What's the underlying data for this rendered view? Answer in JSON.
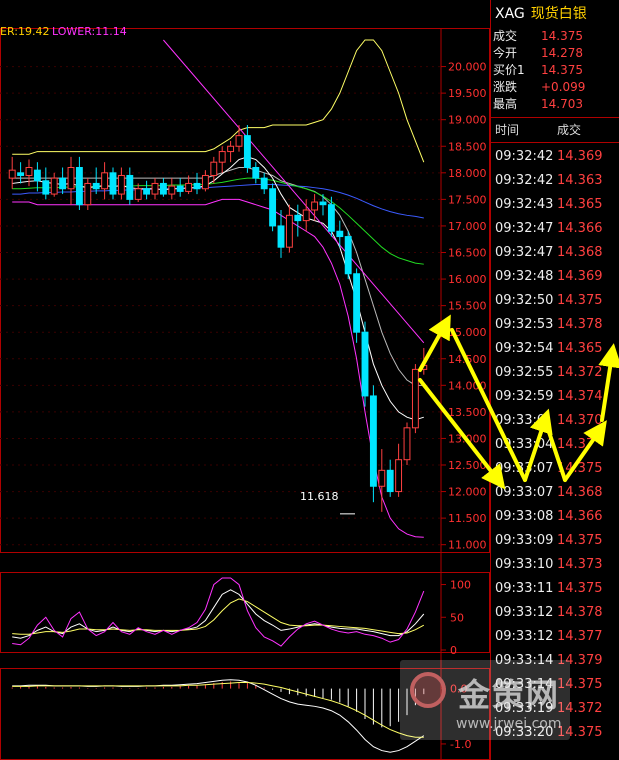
{
  "indicator_header": {
    "upper": "ER:19.42",
    "lower": "LOWER:11.14"
  },
  "low_label": "11.618",
  "price_axis": [
    "20.000",
    "19.500",
    "19.000",
    "18.500",
    "18.000",
    "17.500",
    "17.000",
    "16.500",
    "16.000",
    "15.500",
    "15.000",
    "14.500",
    "14.000",
    "13.500",
    "13.000",
    "12.500",
    "12.000",
    "11.500",
    "11.000"
  ],
  "kdj_axis": [
    "100",
    "50",
    "0"
  ],
  "macd_axis": [
    "0.0",
    "-1.0"
  ],
  "sidebar": {
    "code": "XAG",
    "name": "现货白银",
    "quote": [
      {
        "label": "成交",
        "value": "14.375"
      },
      {
        "label": "今开",
        "value": "14.278"
      },
      {
        "label": "买价1",
        "value": "14.375"
      },
      {
        "label": "涨跌",
        "value": "+0.099"
      },
      {
        "label": "最高",
        "value": "14.703"
      }
    ],
    "ticks_header": {
      "time": "时间",
      "price": "成交"
    },
    "ticks": [
      {
        "time": "09:32:42",
        "price": "14.369"
      },
      {
        "time": "09:32:42",
        "price": "14.363"
      },
      {
        "time": "09:32:43",
        "price": "14.365"
      },
      {
        "time": "09:32:47",
        "price": "14.366"
      },
      {
        "time": "09:32:47",
        "price": "14.368"
      },
      {
        "time": "09:32:48",
        "price": "14.369"
      },
      {
        "time": "09:32:50",
        "price": "14.375"
      },
      {
        "time": "09:32:53",
        "price": "14.378"
      },
      {
        "time": "09:32:54",
        "price": "14.365"
      },
      {
        "time": "09:32:55",
        "price": "14.372"
      },
      {
        "time": "09:32:59",
        "price": "14.374"
      },
      {
        "time": "09:33:0",
        "price": "14.370"
      },
      {
        "time": "09:33:04",
        "price": "14.37"
      },
      {
        "time": "09:33:07",
        "price": "14.375"
      },
      {
        "time": "09:33:07",
        "price": "14.368"
      },
      {
        "time": "09:33:08",
        "price": "14.366"
      },
      {
        "time": "09:33:09",
        "price": "14.375"
      },
      {
        "time": "09:33:10",
        "price": "14.373"
      },
      {
        "time": "09:33:11",
        "price": "14.375"
      },
      {
        "time": "09:33:12",
        "price": "14.378"
      },
      {
        "time": "09:33:12",
        "price": "14.377"
      },
      {
        "time": "09:33:14",
        "price": "14.379"
      },
      {
        "time": "09:33:14",
        "price": "14.375"
      },
      {
        "time": "09:33:19",
        "price": "14.372"
      },
      {
        "time": "09:33:20",
        "price": "14.375"
      }
    ]
  },
  "watermark": {
    "text": "金策网",
    "url": "www.jrwei.com"
  },
  "colors": {
    "up": "#ff4040",
    "down": "#00e5ff",
    "upper_band": "#ffff66",
    "lower_band": "#ff33ff",
    "arrow": "#ffff00"
  },
  "chart_data": {
    "type": "candlestick",
    "ylim": [
      10.9,
      20.5
    ],
    "candles": [
      {
        "o": 17.9,
        "h": 18.3,
        "l": 17.7,
        "c": 18.05
      },
      {
        "o": 18.0,
        "h": 18.2,
        "l": 17.8,
        "c": 17.95
      },
      {
        "o": 17.95,
        "h": 18.25,
        "l": 17.75,
        "c": 18.1
      },
      {
        "o": 18.05,
        "h": 18.2,
        "l": 17.65,
        "c": 17.85
      },
      {
        "o": 17.85,
        "h": 18.1,
        "l": 17.5,
        "c": 17.6
      },
      {
        "o": 17.6,
        "h": 18.0,
        "l": 17.55,
        "c": 17.9
      },
      {
        "o": 17.9,
        "h": 18.1,
        "l": 17.6,
        "c": 17.7
      },
      {
        "o": 17.7,
        "h": 18.3,
        "l": 17.4,
        "c": 18.1
      },
      {
        "o": 18.1,
        "h": 18.3,
        "l": 17.3,
        "c": 17.4
      },
      {
        "o": 17.4,
        "h": 17.9,
        "l": 17.3,
        "c": 17.8
      },
      {
        "o": 17.8,
        "h": 18.1,
        "l": 17.6,
        "c": 17.7
      },
      {
        "o": 17.7,
        "h": 18.2,
        "l": 17.5,
        "c": 18.0
      },
      {
        "o": 18.0,
        "h": 18.1,
        "l": 17.5,
        "c": 17.6
      },
      {
        "o": 17.6,
        "h": 18.1,
        "l": 17.5,
        "c": 17.95
      },
      {
        "o": 17.95,
        "h": 18.1,
        "l": 17.4,
        "c": 17.5
      },
      {
        "o": 17.5,
        "h": 17.8,
        "l": 17.45,
        "c": 17.7
      },
      {
        "o": 17.7,
        "h": 17.85,
        "l": 17.5,
        "c": 17.6
      },
      {
        "o": 17.6,
        "h": 17.9,
        "l": 17.5,
        "c": 17.8
      },
      {
        "o": 17.8,
        "h": 17.9,
        "l": 17.55,
        "c": 17.6
      },
      {
        "o": 17.6,
        "h": 17.9,
        "l": 17.5,
        "c": 17.75
      },
      {
        "o": 17.75,
        "h": 17.9,
        "l": 17.55,
        "c": 17.65
      },
      {
        "o": 17.65,
        "h": 17.95,
        "l": 17.6,
        "c": 17.8
      },
      {
        "o": 17.8,
        "h": 18.0,
        "l": 17.6,
        "c": 17.7
      },
      {
        "o": 17.7,
        "h": 18.05,
        "l": 17.65,
        "c": 17.95
      },
      {
        "o": 17.95,
        "h": 18.3,
        "l": 17.8,
        "c": 18.2
      },
      {
        "o": 18.2,
        "h": 18.5,
        "l": 18.0,
        "c": 18.4
      },
      {
        "o": 18.4,
        "h": 18.6,
        "l": 18.2,
        "c": 18.5
      },
      {
        "o": 18.5,
        "h": 18.9,
        "l": 18.4,
        "c": 18.7
      },
      {
        "o": 18.7,
        "h": 18.9,
        "l": 18.0,
        "c": 18.1
      },
      {
        "o": 18.1,
        "h": 18.2,
        "l": 17.8,
        "c": 17.9
      },
      {
        "o": 17.9,
        "h": 18.0,
        "l": 17.6,
        "c": 17.7
      },
      {
        "o": 17.7,
        "h": 17.8,
        "l": 16.9,
        "c": 17.0
      },
      {
        "o": 17.0,
        "h": 17.3,
        "l": 16.4,
        "c": 16.6
      },
      {
        "o": 16.6,
        "h": 17.4,
        "l": 16.5,
        "c": 17.2
      },
      {
        "o": 17.2,
        "h": 17.4,
        "l": 16.8,
        "c": 17.1
      },
      {
        "o": 17.1,
        "h": 17.5,
        "l": 16.9,
        "c": 17.3
      },
      {
        "o": 17.3,
        "h": 17.6,
        "l": 17.1,
        "c": 17.45
      },
      {
        "o": 17.45,
        "h": 17.6,
        "l": 17.2,
        "c": 17.4
      },
      {
        "o": 17.4,
        "h": 17.55,
        "l": 16.8,
        "c": 16.9
      },
      {
        "o": 16.9,
        "h": 17.1,
        "l": 16.6,
        "c": 16.8
      },
      {
        "o": 16.8,
        "h": 16.9,
        "l": 16.0,
        "c": 16.1
      },
      {
        "o": 16.1,
        "h": 16.2,
        "l": 14.8,
        "c": 15.0
      },
      {
        "o": 15.0,
        "h": 15.2,
        "l": 13.6,
        "c": 13.8
      },
      {
        "o": 13.8,
        "h": 14.0,
        "l": 11.8,
        "c": 12.1
      },
      {
        "o": 12.1,
        "h": 12.8,
        "l": 11.618,
        "c": 12.4
      },
      {
        "o": 12.4,
        "h": 12.6,
        "l": 11.9,
        "c": 12.0
      },
      {
        "o": 12.0,
        "h": 12.9,
        "l": 11.9,
        "c": 12.6
      },
      {
        "o": 12.6,
        "h": 13.3,
        "l": 12.5,
        "c": 13.2
      },
      {
        "o": 13.2,
        "h": 14.4,
        "l": 13.1,
        "c": 14.3
      },
      {
        "o": 14.3,
        "h": 14.703,
        "l": 14.2,
        "c": 14.375
      }
    ],
    "upper_band": [
      18.35,
      18.35,
      18.35,
      18.4,
      18.4,
      18.4,
      18.4,
      18.4,
      18.4,
      18.4,
      18.4,
      18.4,
      18.4,
      18.4,
      18.4,
      18.4,
      18.4,
      18.4,
      18.4,
      18.4,
      18.4,
      18.4,
      18.4,
      18.4,
      18.45,
      18.55,
      18.65,
      18.8,
      18.85,
      18.85,
      18.85,
      18.9,
      18.9,
      18.9,
      18.9,
      18.9,
      18.95,
      19.0,
      19.2,
      19.5,
      19.9,
      20.3,
      20.5,
      20.5,
      20.3,
      19.9,
      19.5,
      19.0,
      18.6,
      18.2
    ],
    "lower_band": [
      17.45,
      17.45,
      17.45,
      17.4,
      17.4,
      17.4,
      17.4,
      17.4,
      17.4,
      17.4,
      17.4,
      17.4,
      17.4,
      17.4,
      17.4,
      17.4,
      17.4,
      17.4,
      17.4,
      17.4,
      17.4,
      17.4,
      17.4,
      17.4,
      17.45,
      17.5,
      17.5,
      17.5,
      17.45,
      17.4,
      17.35,
      17.3,
      17.2,
      17.1,
      17.0,
      16.9,
      16.8,
      16.6,
      16.3,
      15.9,
      15.3,
      14.5,
      13.5,
      12.6,
      11.9,
      11.5,
      11.3,
      11.2,
      11.15,
      11.14
    ],
    "mid_line": [
      17.9,
      17.9,
      17.9,
      17.9,
      17.9,
      17.9,
      17.9,
      17.9,
      17.9,
      17.9,
      17.9,
      17.9,
      17.9,
      17.9,
      17.9,
      17.9,
      17.9,
      17.9,
      17.9,
      17.9,
      17.9,
      17.9,
      17.9,
      17.9,
      17.95,
      18.0,
      18.05,
      18.1,
      18.1,
      18.05,
      18.0,
      17.95,
      17.85,
      17.8,
      17.75,
      17.7,
      17.65,
      17.55,
      17.4,
      17.2,
      16.9,
      16.5,
      16.0,
      15.5,
      15.0,
      14.6,
      14.3,
      14.1,
      14.0,
      14.0
    ],
    "ma_lines": [
      {
        "color": "#3b5bff",
        "values": [
          17.6,
          17.6,
          17.62,
          17.62,
          17.63,
          17.63,
          17.64,
          17.64,
          17.65,
          17.65,
          17.66,
          17.66,
          17.67,
          17.67,
          17.68,
          17.68,
          17.69,
          17.69,
          17.7,
          17.7,
          17.71,
          17.71,
          17.72,
          17.72,
          17.73,
          17.74,
          17.75,
          17.76,
          17.77,
          17.78,
          17.78,
          17.78,
          17.77,
          17.76,
          17.75,
          17.74,
          17.72,
          17.7,
          17.67,
          17.63,
          17.58,
          17.52,
          17.45,
          17.38,
          17.32,
          17.27,
          17.23,
          17.2,
          17.18,
          17.15
        ]
      },
      {
        "color": "#22dd22",
        "values": [
          17.7,
          17.7,
          17.71,
          17.72,
          17.72,
          17.72,
          17.73,
          17.73,
          17.74,
          17.74,
          17.74,
          17.75,
          17.75,
          17.75,
          17.75,
          17.76,
          17.76,
          17.76,
          17.76,
          17.77,
          17.77,
          17.77,
          17.78,
          17.78,
          17.8,
          17.82,
          17.85,
          17.88,
          17.9,
          17.9,
          17.88,
          17.86,
          17.82,
          17.78,
          17.74,
          17.7,
          17.64,
          17.56,
          17.46,
          17.34,
          17.2,
          17.05,
          16.9,
          16.75,
          16.6,
          16.48,
          16.4,
          16.35,
          16.3,
          16.28
        ]
      },
      {
        "color": "#ffffff",
        "values": [
          17.8,
          17.82,
          17.84,
          17.85,
          17.82,
          17.8,
          17.78,
          17.8,
          17.75,
          17.72,
          17.74,
          17.76,
          17.74,
          17.76,
          17.72,
          17.7,
          17.7,
          17.7,
          17.68,
          17.7,
          17.7,
          17.72,
          17.72,
          17.76,
          17.85,
          17.98,
          18.1,
          18.25,
          18.3,
          18.25,
          18.1,
          17.9,
          17.6,
          17.35,
          17.25,
          17.15,
          17.1,
          17.05,
          16.9,
          16.6,
          16.1,
          15.6,
          15.0,
          14.4,
          14.0,
          13.7,
          13.5,
          13.4,
          13.35,
          13.4
        ]
      }
    ],
    "kdj": {
      "ylim": [
        0,
        110
      ],
      "k": [
        20,
        18,
        22,
        30,
        35,
        28,
        25,
        35,
        40,
        32,
        28,
        30,
        35,
        30,
        28,
        32,
        30,
        28,
        30,
        28,
        30,
        32,
        35,
        45,
        65,
        85,
        92,
        85,
        70,
        55,
        45,
        38,
        30,
        32,
        35,
        38,
        40,
        38,
        35,
        33,
        32,
        32,
        30,
        28,
        25,
        22,
        22,
        28,
        40,
        55
      ],
      "d": [
        25,
        24,
        24,
        26,
        28,
        28,
        27,
        29,
        32,
        32,
        31,
        31,
        32,
        31,
        30,
        31,
        31,
        30,
        30,
        30,
        30,
        31,
        32,
        36,
        46,
        60,
        72,
        78,
        74,
        66,
        58,
        50,
        42,
        38,
        37,
        37,
        38,
        38,
        37,
        36,
        35,
        34,
        33,
        31,
        29,
        27,
        25,
        26,
        31,
        38
      ],
      "j": [
        10,
        8,
        18,
        38,
        50,
        30,
        20,
        48,
        58,
        32,
        22,
        28,
        42,
        28,
        24,
        34,
        28,
        24,
        30,
        24,
        30,
        34,
        42,
        62,
        100,
        118,
        118,
        100,
        60,
        34,
        20,
        14,
        6,
        20,
        32,
        40,
        44,
        38,
        32,
        28,
        26,
        28,
        24,
        22,
        18,
        12,
        16,
        32,
        58,
        90
      ]
    },
    "macd": {
      "ylim": [
        -1.2,
        0.3
      ],
      "hist": [
        0.02,
        0.03,
        0.03,
        0.04,
        0.03,
        0.02,
        0.02,
        0.03,
        0.02,
        0.01,
        0.01,
        0.02,
        0.02,
        0.01,
        0.01,
        0.01,
        0.02,
        0.02,
        0.03,
        0.03,
        0.04,
        0.05,
        0.06,
        0.08,
        0.1,
        0.12,
        0.13,
        0.12,
        0.1,
        0.06,
        0.02,
        -0.02,
        -0.06,
        -0.1,
        -0.12,
        -0.14,
        -0.15,
        -0.17,
        -0.2,
        -0.25,
        -0.32,
        -0.42,
        -0.55,
        -0.65,
        -0.7,
        -0.68,
        -0.6,
        -0.48,
        -0.3,
        -0.1
      ],
      "dif": [
        0.05,
        0.05,
        0.06,
        0.06,
        0.06,
        0.05,
        0.05,
        0.05,
        0.05,
        0.04,
        0.04,
        0.05,
        0.05,
        0.04,
        0.04,
        0.04,
        0.05,
        0.05,
        0.06,
        0.06,
        0.07,
        0.08,
        0.09,
        0.11,
        0.13,
        0.15,
        0.16,
        0.15,
        0.12,
        0.06,
        -0.02,
        -0.1,
        -0.18,
        -0.24,
        -0.28,
        -0.3,
        -0.32,
        -0.35,
        -0.4,
        -0.48,
        -0.6,
        -0.75,
        -0.92,
        -1.05,
        -1.12,
        -1.15,
        -1.12,
        -1.05,
        -0.95,
        -0.85
      ],
      "dea": [
        0.04,
        0.04,
        0.04,
        0.05,
        0.05,
        0.05,
        0.05,
        0.05,
        0.05,
        0.05,
        0.05,
        0.05,
        0.05,
        0.05,
        0.05,
        0.05,
        0.05,
        0.05,
        0.05,
        0.05,
        0.05,
        0.06,
        0.06,
        0.07,
        0.08,
        0.09,
        0.1,
        0.11,
        0.11,
        0.1,
        0.08,
        0.05,
        0.02,
        -0.02,
        -0.06,
        -0.1,
        -0.14,
        -0.18,
        -0.22,
        -0.27,
        -0.33,
        -0.4,
        -0.48,
        -0.57,
        -0.66,
        -0.74,
        -0.8,
        -0.85,
        -0.88,
        -0.88
      ]
    }
  }
}
